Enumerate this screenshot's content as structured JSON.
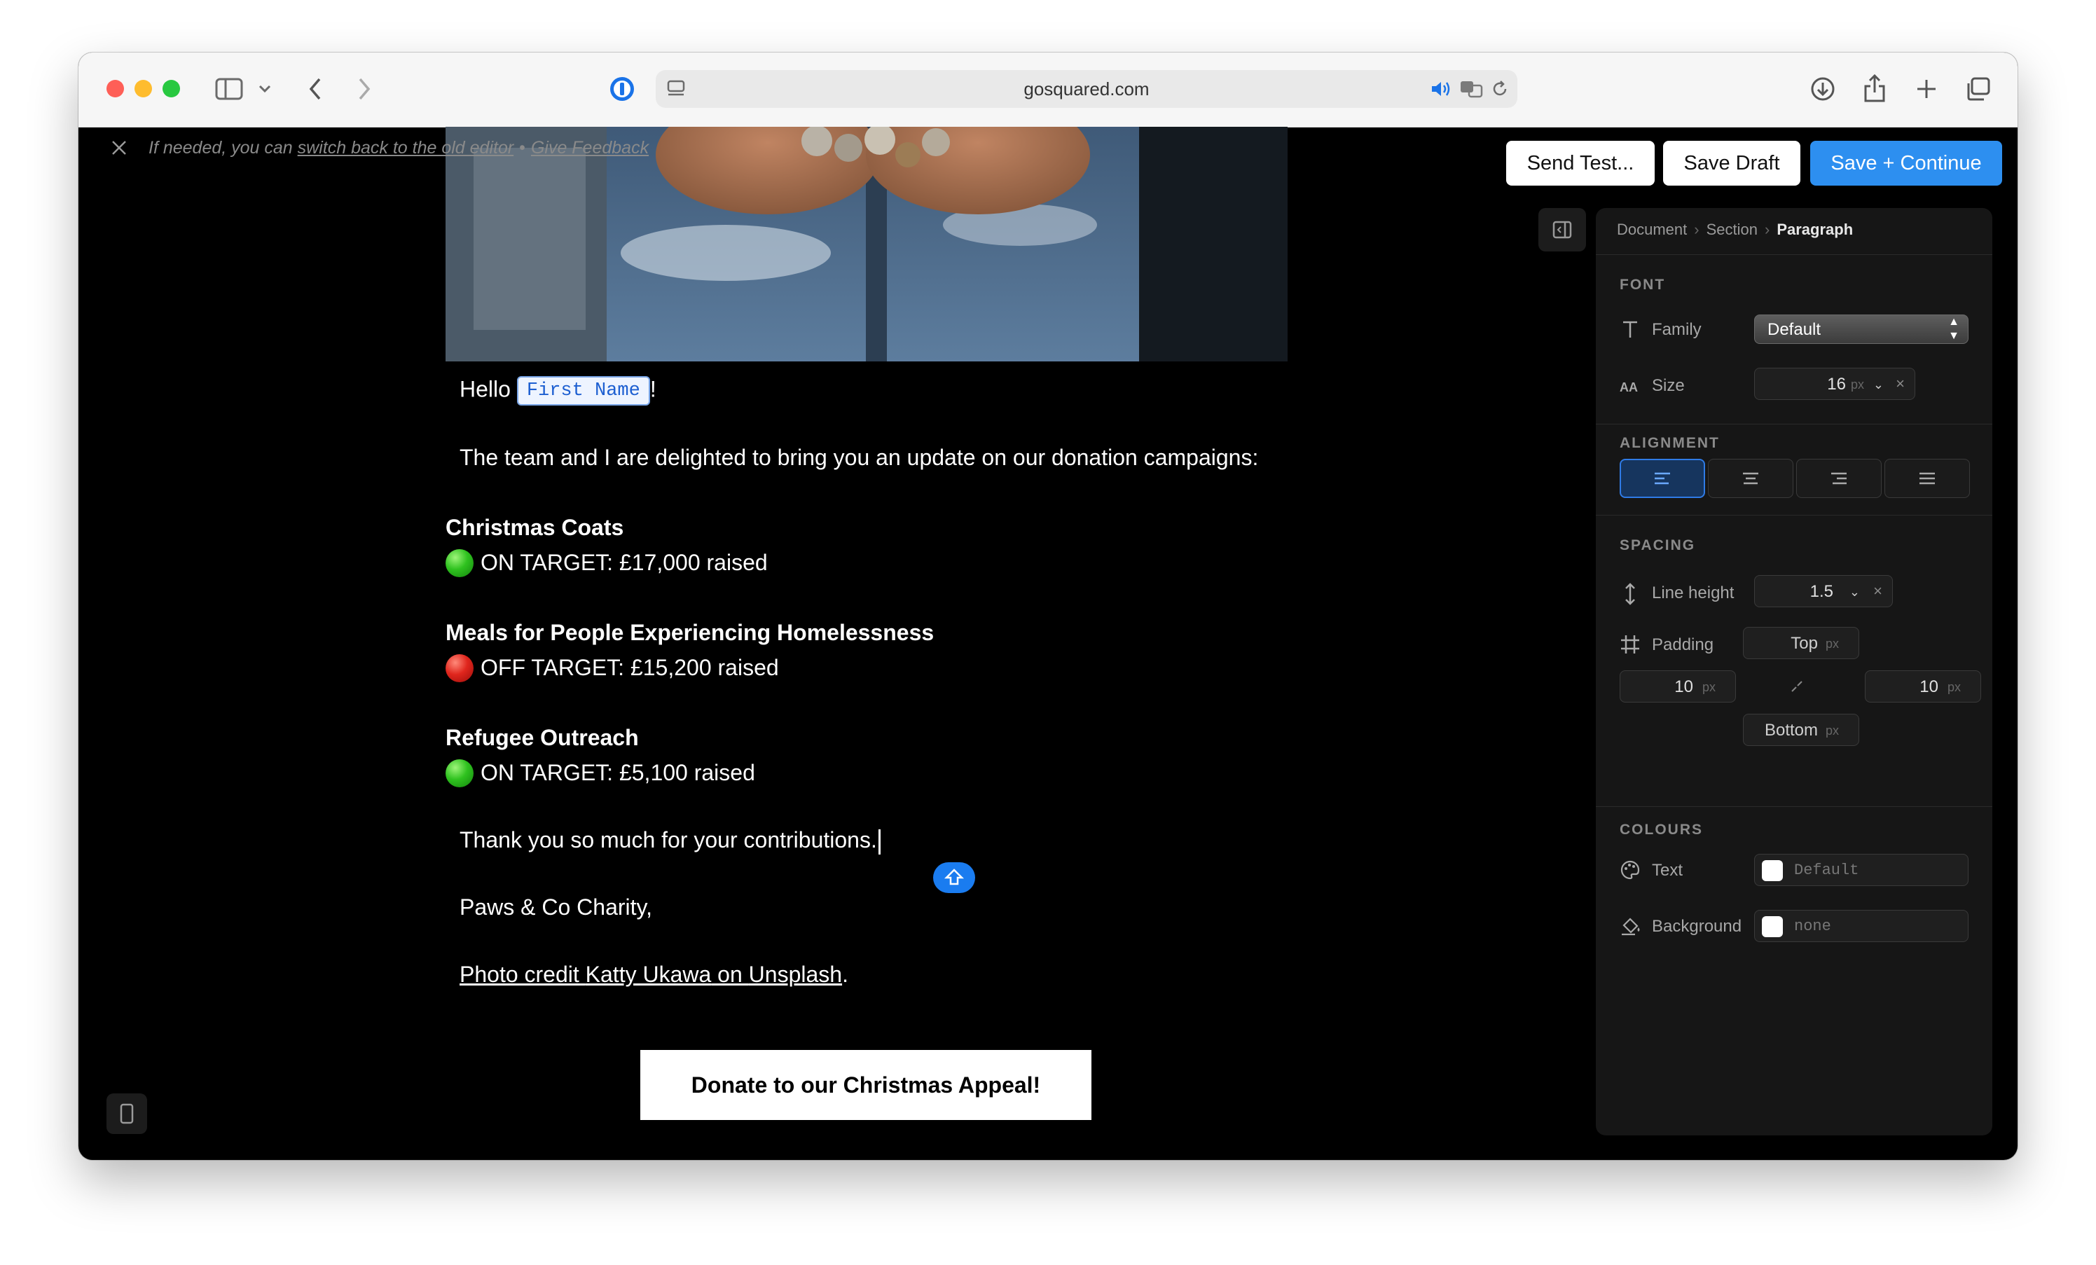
{
  "browser": {
    "url": "gosquared.com"
  },
  "notice": {
    "text_before": "If needed, you can ",
    "switch_link": "switch back to the old editor",
    "separator": "•",
    "feedback_link": "Give Feedback"
  },
  "actions": {
    "send_test": "Send Test...",
    "save_draft": "Save Draft",
    "save_continue": "Save + Continue"
  },
  "email": {
    "greeting": "Hello",
    "merge_tag": "First Name",
    "greeting_end": "!",
    "intro": "The team and I are delighted to bring you an update on our donation campaigns:",
    "campaigns": [
      {
        "title": "Christmas Coats",
        "status": "ON TARGET: £17,000 raised",
        "indicator": "green"
      },
      {
        "title": "Meals for People Experiencing Homelessness",
        "status": "OFF TARGET: £15,200 raised",
        "indicator": "red"
      },
      {
        "title": "Refugee Outreach",
        "status": "ON TARGET: £5,100 raised",
        "indicator": "green"
      }
    ],
    "thanks": "Thank you so much for your contributions.",
    "signoff": "Paws & Co Charity,",
    "credit_prefix": "Photo credit ",
    "credit_author": "Katty Ukawa",
    "credit_on": " on ",
    "credit_site": "Unsplash",
    "credit_end": ".",
    "donate_button": "Donate to our Christmas Appeal!"
  },
  "panel": {
    "breadcrumb": [
      "Document",
      "Section",
      "Paragraph"
    ],
    "font": {
      "title": "FONT",
      "family_label": "Family",
      "family_value": "Default",
      "size_label": "Size",
      "size_value": "16",
      "size_unit": "px"
    },
    "alignment": {
      "title": "ALIGNMENT",
      "options": [
        "left",
        "center",
        "right",
        "justify"
      ],
      "selected": "left"
    },
    "spacing": {
      "title": "SPACING",
      "line_height_label": "Line height",
      "line_height_value": "1.5",
      "padding_label": "Padding",
      "top_placeholder": "Top",
      "bottom_placeholder": "Bottom",
      "left_value": "10",
      "right_value": "10",
      "unit": "px"
    },
    "colours": {
      "title": "COLOURS",
      "text_label": "Text",
      "text_placeholder": "Default",
      "background_label": "Background",
      "background_placeholder": "none"
    }
  },
  "colors": {
    "accent": "#2d8ff0",
    "on_target": "#2fc21f",
    "off_target": "#e0261d"
  }
}
